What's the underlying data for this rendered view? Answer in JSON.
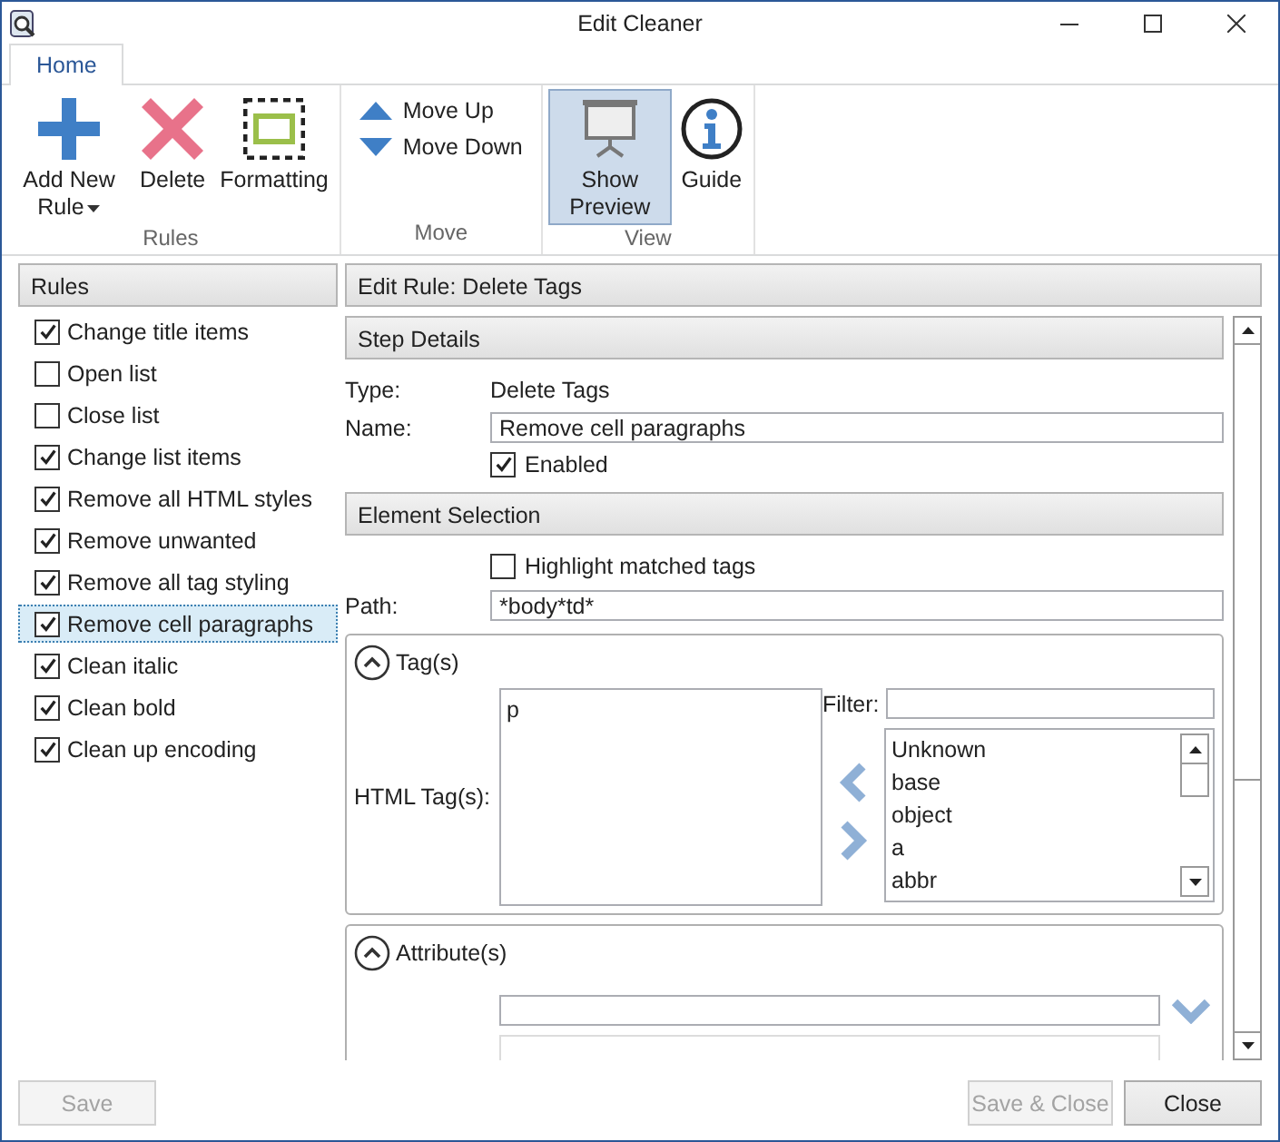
{
  "window": {
    "title": "Edit Cleaner"
  },
  "ribbon": {
    "tabs": [
      {
        "label": "Home",
        "selected": true
      }
    ],
    "groups": [
      {
        "label": "Rules",
        "buttons": [
          {
            "kind": "add",
            "label": "Add New Rule",
            "has_menu": true,
            "selected": false
          },
          {
            "kind": "delete",
            "label": "Delete",
            "selected": false
          },
          {
            "kind": "formatting",
            "label": "Formatting",
            "selected": false
          }
        ]
      },
      {
        "label": "Move",
        "buttons": [
          {
            "kind": "up",
            "label": "Move Up",
            "selected": false
          },
          {
            "kind": "down",
            "label": "Move Down",
            "selected": false
          }
        ]
      },
      {
        "label": "View",
        "buttons": [
          {
            "kind": "preview",
            "label": "Show Preview",
            "selected": true
          },
          {
            "kind": "guide",
            "label": "Guide",
            "selected": false
          }
        ]
      }
    ]
  },
  "rules": {
    "title": "Rules",
    "items": [
      {
        "label": "Change title items",
        "checked": true,
        "selected": false
      },
      {
        "label": "Open list",
        "checked": false,
        "selected": false
      },
      {
        "label": "Close list",
        "checked": false,
        "selected": false
      },
      {
        "label": "Change list items",
        "checked": true,
        "selected": false
      },
      {
        "label": "Remove all HTML styles",
        "checked": true,
        "selected": false
      },
      {
        "label": "Remove unwanted",
        "checked": true,
        "selected": false
      },
      {
        "label": "Remove all tag styling",
        "checked": true,
        "selected": false
      },
      {
        "label": "Remove cell paragraphs",
        "checked": true,
        "selected": true
      },
      {
        "label": "Clean italic",
        "checked": true,
        "selected": false
      },
      {
        "label": "Clean bold",
        "checked": true,
        "selected": false
      },
      {
        "label": "Clean up encoding",
        "checked": true,
        "selected": false
      }
    ]
  },
  "editor": {
    "title": "Edit Rule: Delete Tags",
    "step_details": {
      "title": "Step Details",
      "type_label": "Type:",
      "type_value": "Delete Tags",
      "name_label": "Name:",
      "name_value": "Remove cell paragraphs",
      "enabled": {
        "label": "Enabled",
        "checked": true
      }
    },
    "element_selection": {
      "title": "Element Selection",
      "highlight": {
        "label": "Highlight matched tags",
        "checked": false
      },
      "path_label": "Path:",
      "path_value": "*body*td*"
    },
    "tags": {
      "title": "Tag(s)",
      "expanded": true,
      "html_tags_label": "HTML Tag(s):",
      "selected_tags": [
        "p"
      ],
      "filter_label": "Filter:",
      "available_tags": [
        "Unknown",
        "base",
        "object",
        "a",
        "abbr"
      ]
    },
    "attributes": {
      "title": "Attribute(s)",
      "expanded": true
    }
  },
  "footer": {
    "buttons": [
      {
        "label": "Save",
        "disabled": true
      },
      {
        "label": "Save & Close",
        "disabled": true
      },
      {
        "label": "Close",
        "disabled": false
      }
    ]
  }
}
